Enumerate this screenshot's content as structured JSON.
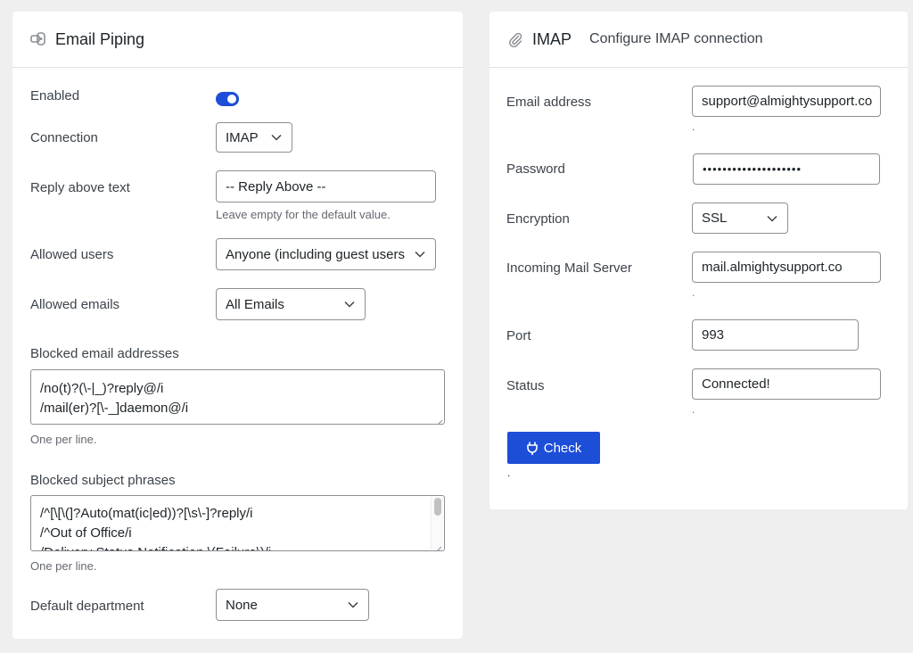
{
  "piping": {
    "title": "Email Piping",
    "icon": "pipe-icon",
    "enabled_label": "Enabled",
    "enabled": true,
    "connection_label": "Connection",
    "connection_value": "IMAP",
    "reply_above_label": "Reply above text",
    "reply_above_value": "-- Reply Above --",
    "reply_above_help": "Leave empty for the default value.",
    "allowed_users_label": "Allowed users",
    "allowed_users_value": "Anyone (including guest users)",
    "allowed_emails_label": "Allowed emails",
    "allowed_emails_value": "All Emails",
    "blocked_addresses_label": "Blocked email addresses",
    "blocked_addresses": [
      "/no(t)?(\\-|_)?reply@/i",
      "/mail(er)?[\\-_]daemon@/i"
    ],
    "blocked_addresses_help": "One per line.",
    "blocked_subjects_label": "Blocked subject phrases",
    "blocked_subjects": [
      "/^[\\[\\(]?Auto(mat(ic|ed))?[\\s\\-]?reply/i",
      "/^Out of Office/i",
      "/Delivery Status Notification \\(Failure\\)/i"
    ],
    "blocked_subjects_help": "One per line.",
    "default_department_label": "Default department",
    "default_department_value": "None"
  },
  "imap": {
    "title": "IMAP",
    "subtitle": "Configure IMAP connection",
    "icon": "paperclip-icon",
    "email_label": "Email address",
    "email_value": "support@almightysupport.co",
    "password_label": "Password",
    "password_value": "••••••••••••••••••••",
    "encryption_label": "Encryption",
    "encryption_value": "SSL",
    "server_label": "Incoming Mail Server",
    "server_value": "mail.almightysupport.co",
    "port_label": "Port",
    "port_value": "993",
    "status_label": "Status",
    "status_value": "Connected!",
    "check_label": "Check",
    "check_icon": "plug-icon",
    "help_dot": "."
  },
  "colors": {
    "accent": "#1d4ed8",
    "background": "#efefef"
  }
}
